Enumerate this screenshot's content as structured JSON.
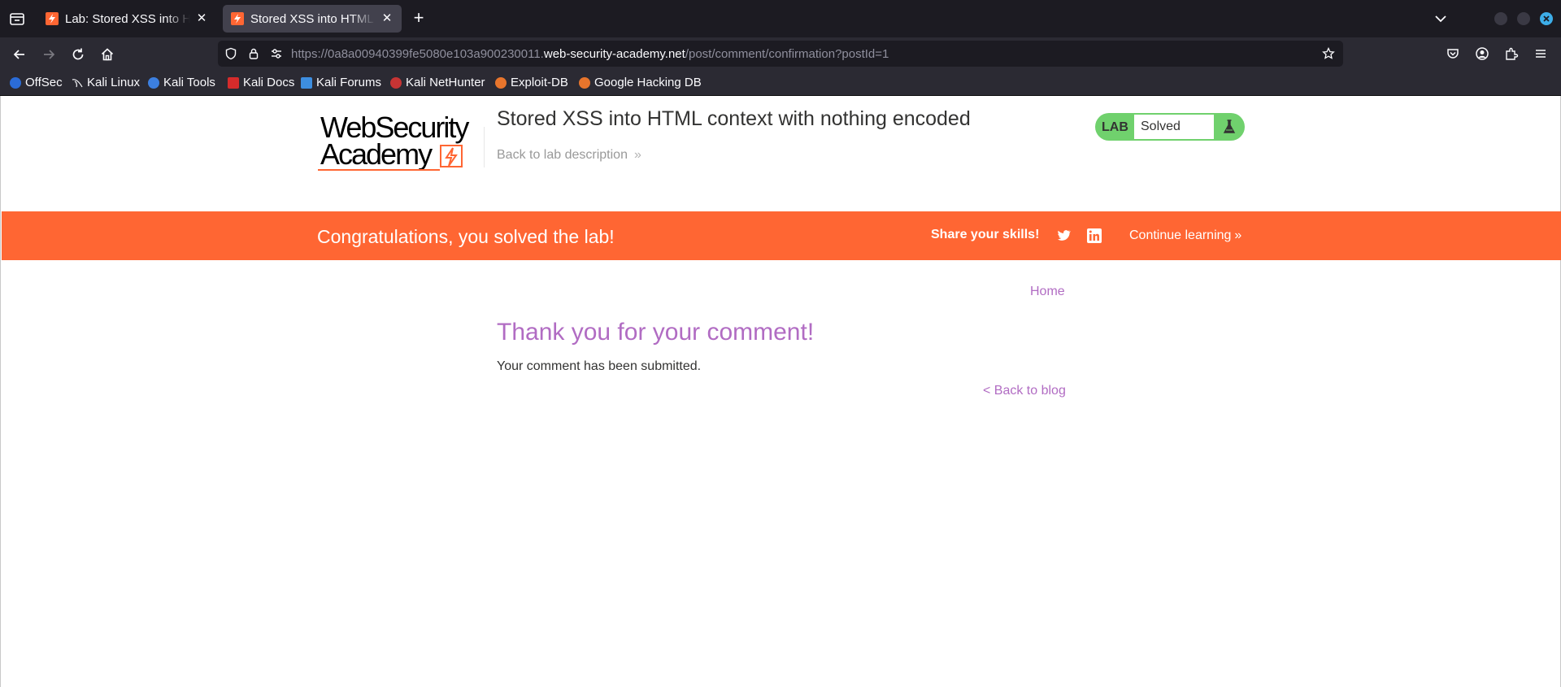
{
  "browser": {
    "tabs": [
      {
        "title": "Lab: Stored XSS into HTML context with nothing encoded",
        "active": false
      },
      {
        "title": "Stored XSS into HTML context with nothing encoded",
        "active": true
      }
    ],
    "url": {
      "prefix": "https://0a8a00940399fe5080e103a900230011.",
      "domain": "web-security-academy.net",
      "path": "/post/comment/confirmation?postId=1"
    },
    "bookmarks": [
      {
        "label": "OffSec",
        "icon": "offsec-icon"
      },
      {
        "label": "Kali Linux",
        "icon": "kali-linux-icon"
      },
      {
        "label": "Kali Tools",
        "icon": "kali-tools-icon"
      },
      {
        "label": "Kali Docs",
        "icon": "kali-docs-icon"
      },
      {
        "label": "Kali Forums",
        "icon": "kali-forums-icon"
      },
      {
        "label": "Kali NetHunter",
        "icon": "kali-nethunter-icon"
      },
      {
        "label": "Exploit-DB",
        "icon": "exploit-db-icon"
      },
      {
        "label": "Google Hacking DB",
        "icon": "google-hacking-db-icon"
      }
    ]
  },
  "header": {
    "logo_line1": "WebSecurity",
    "logo_line2": "Academy",
    "lab_title": "Stored XSS into HTML context with nothing encoded",
    "back_link": "Back to lab description",
    "status_label": "LAB",
    "status_value": "Solved"
  },
  "banner": {
    "message": "Congratulations, you solved the lab!",
    "share_label": "Share your skills!",
    "continue_label": "Continue learning"
  },
  "main": {
    "home_link": "Home",
    "heading": "Thank you for your comment!",
    "message": "Your comment has been submitted.",
    "back_link": "< Back to blog"
  },
  "colors": {
    "accent_orange": "#ff6633",
    "link_purple": "#b16cc3",
    "solved_green": "#70d16d"
  }
}
